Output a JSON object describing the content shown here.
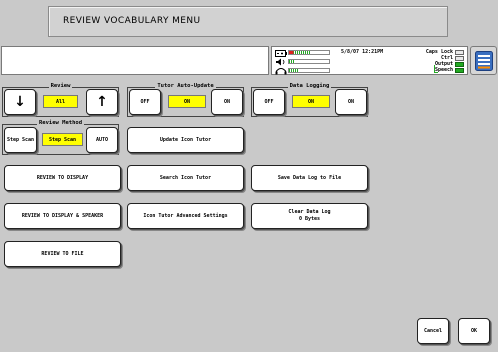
{
  "title": "REVIEW VOCABULARY MENU",
  "status": {
    "datetime": "5/8/07 12:21PM",
    "indicators": [
      {
        "label": "Caps Lock",
        "on": false
      },
      {
        "label": "Ctrl",
        "on": false
      },
      {
        "label": "Output",
        "on": true
      },
      {
        "label": "Speech",
        "on": true
      }
    ],
    "battery_level": 0.55,
    "volume_level": 0.15,
    "headphone_level": 0.25,
    "battery_color": "#e02020",
    "meter_color": "#22aa22"
  },
  "review": {
    "label": "Review",
    "down_symbol": "↓",
    "up_symbol": "↑",
    "value": "All"
  },
  "tutor_auto_update": {
    "label": "Tutor Auto-Update",
    "off": "OFF",
    "value": "ON",
    "on": "ON"
  },
  "data_logging": {
    "label": "Data Logging",
    "off": "OFF",
    "value": "ON",
    "on": "ON"
  },
  "review_method": {
    "label": "Review Method",
    "step_scan": "Step Scan",
    "value": "Step Scan",
    "auto": "AUTO"
  },
  "buttons": {
    "update_icon_tutor": "Update Icon Tutor",
    "review_to_display": "REVIEW TO DISPLAY",
    "search_icon_tutor": "Search Icon Tutor",
    "save_data_log": "Save Data Log to File",
    "review_display_speaker": "REVIEW TO DISPLAY & SPEAKER",
    "icon_tutor_advanced": "Icon Tutor Advanced Settings",
    "clear_data_log": "Clear Data Log",
    "clear_data_log_size": "0 Bytes",
    "review_to_file": "REVIEW TO FILE",
    "cancel": "Cancel",
    "ok": "OK"
  },
  "icons": {
    "battery": "battery-icon",
    "speaker": "speaker-icon",
    "headphone": "headphone-icon",
    "menu": "menu-icon"
  },
  "colors": {
    "indicator": "#ffff00",
    "background": "#c9c9c9"
  }
}
